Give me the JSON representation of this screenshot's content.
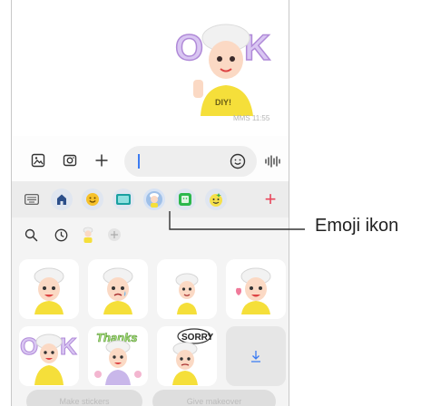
{
  "chat": {
    "timestamp": "MMS 11:55"
  },
  "input_bar": {
    "gallery_icon": "image-icon",
    "camera_icon": "camera-icon",
    "attach_icon": "plus-icon",
    "message_placeholder": "",
    "emoji_icon": "smiley-icon",
    "voice_icon": "voice-wave-icon"
  },
  "keyboard": {
    "tabs": [
      "keyboard-icon",
      "home-icon",
      "emoji-icon",
      "gif-icon",
      "avatar-emoji-icon",
      "sticker-icon",
      "bitmoji-icon",
      "add-icon"
    ],
    "selected_tab": "avatar-emoji-icon",
    "sub_tabs": [
      "search-icon",
      "recent-icon",
      "avatar-icon",
      "add-icon"
    ],
    "stickers": [
      "avatar-wave",
      "avatar-tear",
      "avatar-small",
      "avatar-heart",
      "avatar-ok",
      "avatar-thanks",
      "avatar-sorry",
      "download-icon"
    ],
    "bottom_buttons": [
      "Make stickers",
      "Give makeover"
    ]
  },
  "callout": {
    "label": "Emoji ikon"
  },
  "colors": {
    "accent": "#3b7bf2",
    "plus_red": "#e8475c",
    "selected_tab_bg": "#d7e3f5"
  }
}
